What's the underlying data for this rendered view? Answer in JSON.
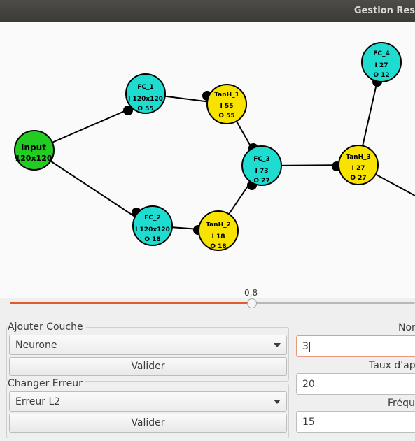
{
  "window": {
    "title": "Gestion Res"
  },
  "graph": {
    "nodes": [
      {
        "id": "input",
        "line1": "Input",
        "line2": "120x120",
        "color": "#22cc22"
      },
      {
        "id": "fc1",
        "name": "FC_1",
        "in": "I 120x120",
        "out": "O 55",
        "color": "#1edcd0"
      },
      {
        "id": "tanh1",
        "name": "TanH_1",
        "in": "I 55",
        "out": "O 55",
        "color": "#f7e200"
      },
      {
        "id": "fc2",
        "name": "FC_2",
        "in": "I 120x120",
        "out": "O 18",
        "color": "#1edcd0"
      },
      {
        "id": "tanh2",
        "name": "TanH_2",
        "in": "I 18",
        "out": "O 18",
        "color": "#f7e200"
      },
      {
        "id": "fc3",
        "name": "FC_3",
        "in": "I 73",
        "out": "O 27",
        "color": "#1edcd0"
      },
      {
        "id": "tanh3",
        "name": "TanH_3",
        "in": "I 27",
        "out": "O 27",
        "color": "#f7e200"
      },
      {
        "id": "fc4",
        "name": "FC_4",
        "in": "I 27",
        "out": "O 12",
        "color": "#1edcd0"
      }
    ]
  },
  "slider": {
    "value_label": "0,8",
    "value": 0.8
  },
  "add_layer": {
    "label": "Ajouter Couche",
    "selected": "Neurone",
    "button": "Valider"
  },
  "change_error": {
    "label": "Changer Erreur",
    "selected": "Erreur L2",
    "button": "Valider"
  },
  "params": {
    "field1": {
      "label": "Nor",
      "value": "3"
    },
    "field2": {
      "label": "Taux d'app",
      "value": "20"
    },
    "field3": {
      "label": "Fréqu",
      "value": "15"
    }
  },
  "colors": {
    "accent": "#e05a2e",
    "titlebar": "#3c3b37"
  }
}
